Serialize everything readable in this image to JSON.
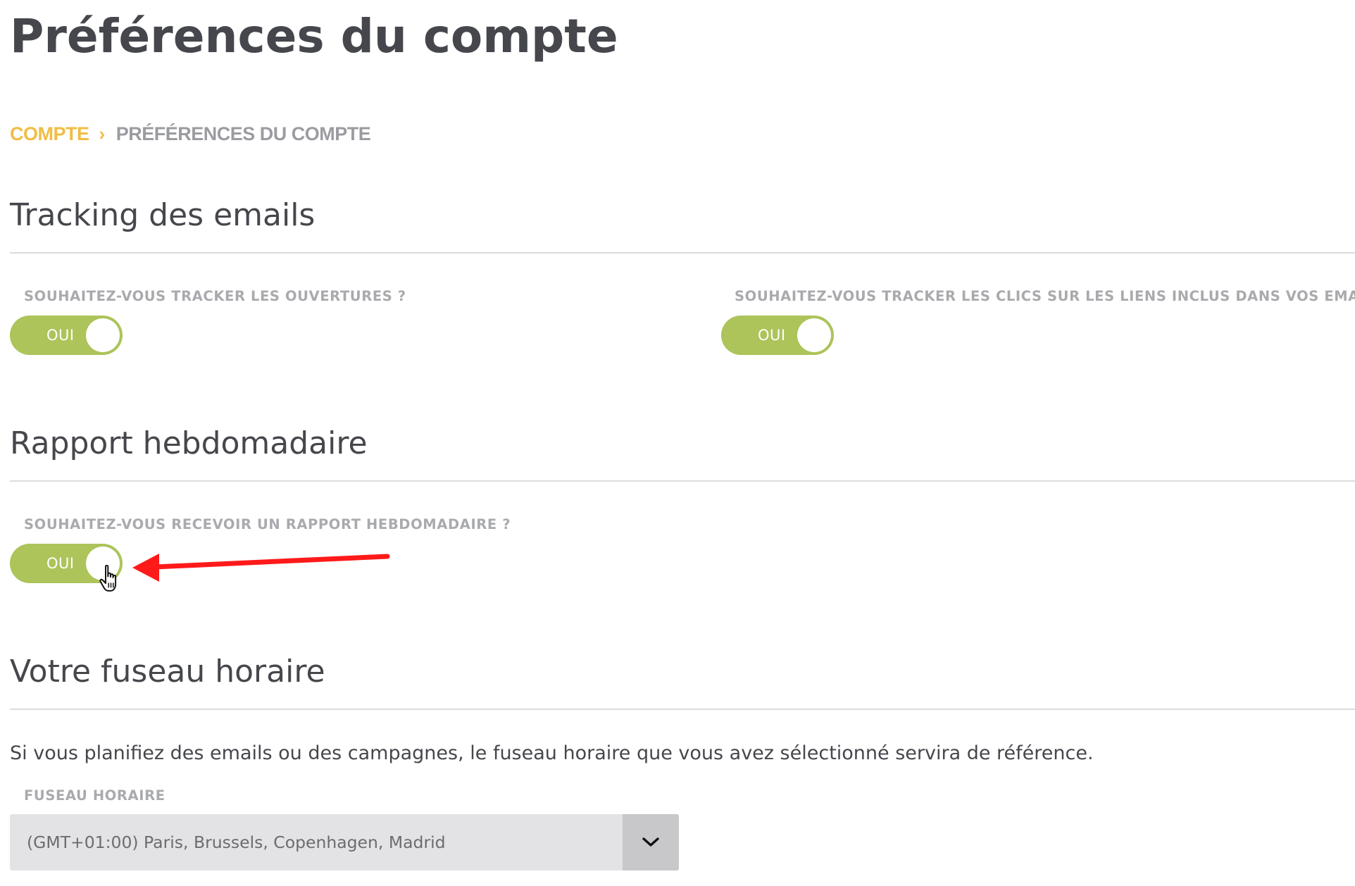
{
  "page": {
    "title": "Préférences du compte"
  },
  "breadcrumb": {
    "parent": "COMPTE",
    "current": "PRÉFÉRENCES DU COMPTE"
  },
  "tracking": {
    "title": "Tracking des emails",
    "opens": {
      "label": "SOUHAITEZ-VOUS TRACKER LES OUVERTURES ?",
      "toggle_text": "OUI",
      "enabled": true
    },
    "clicks": {
      "label": "SOUHAITEZ-VOUS TRACKER LES CLICS SUR LES LIENS INCLUS DANS VOS EMAILS ?",
      "toggle_text": "OUI",
      "enabled": true
    }
  },
  "weekly_report": {
    "title": "Rapport hebdomadaire",
    "receive": {
      "label": "SOUHAITEZ-VOUS RECEVOIR UN RAPPORT HEBDOMADAIRE ?",
      "toggle_text": "OUI",
      "enabled": true
    }
  },
  "timezone": {
    "title": "Votre fuseau horaire",
    "description": "Si vous planifiez des emails ou des campagnes, le fuseau horaire que vous avez sélectionné servira de référence.",
    "label": "FUSEAU HORAIRE",
    "selected": "(GMT+01:00) Paris, Brussels, Copenhagen, Madrid"
  },
  "colors": {
    "accent": "#f0bd45",
    "toggle_on": "#acc45a",
    "annotation": "#ff1a1a"
  },
  "icons": {
    "breadcrumb_separator": "chevron-right-icon",
    "select_caret": "chevron-down-icon",
    "cursor": "hand-pointer-icon",
    "annotation": "arrow-left-icon"
  }
}
